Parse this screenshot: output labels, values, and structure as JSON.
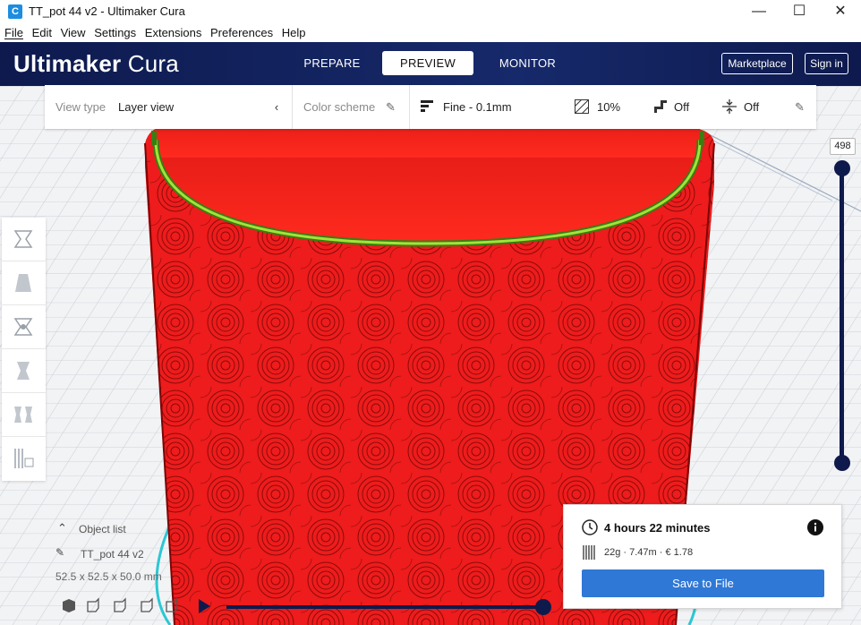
{
  "window": {
    "app_icon": "C",
    "title": "TT_pot 44 v2 - Ultimaker Cura",
    "minimize": "—",
    "maximize": "☐",
    "close": "✕"
  },
  "menu": [
    "File",
    "Edit",
    "View",
    "Settings",
    "Extensions",
    "Preferences",
    "Help"
  ],
  "header": {
    "logo_bold": "Ultimaker",
    "logo_light": "Cura",
    "tabs": [
      {
        "label": "PREPARE",
        "active": false
      },
      {
        "label": "PREVIEW",
        "active": true
      },
      {
        "label": "MONITOR",
        "active": false
      }
    ],
    "marketplace_label": "Marketplace",
    "signin_label": "Sign in"
  },
  "viewbar": {
    "view_type_label": "View type",
    "view_type_value": "Layer view",
    "color_scheme_label": "Color scheme",
    "profile": "Fine - 0.1mm",
    "infill": "10%",
    "support": "Off",
    "adhesion": "Off"
  },
  "layer_slider": {
    "current_layer": "498"
  },
  "object_list": {
    "toggle_label": "Object list",
    "object_name": "TT_pot 44 v2",
    "dimensions": "52.5 x 52.5 x 50.0 mm"
  },
  "print_info": {
    "time": "4 hours 22 minutes",
    "material": "22g · 7.47m · € 1.78",
    "save_label": "Save to File"
  },
  "colors": {
    "header_bg": "#101c4d",
    "accent": "#2f78d6",
    "model_red": "#ee1c1c",
    "top_ring_green": "#7ed321"
  }
}
